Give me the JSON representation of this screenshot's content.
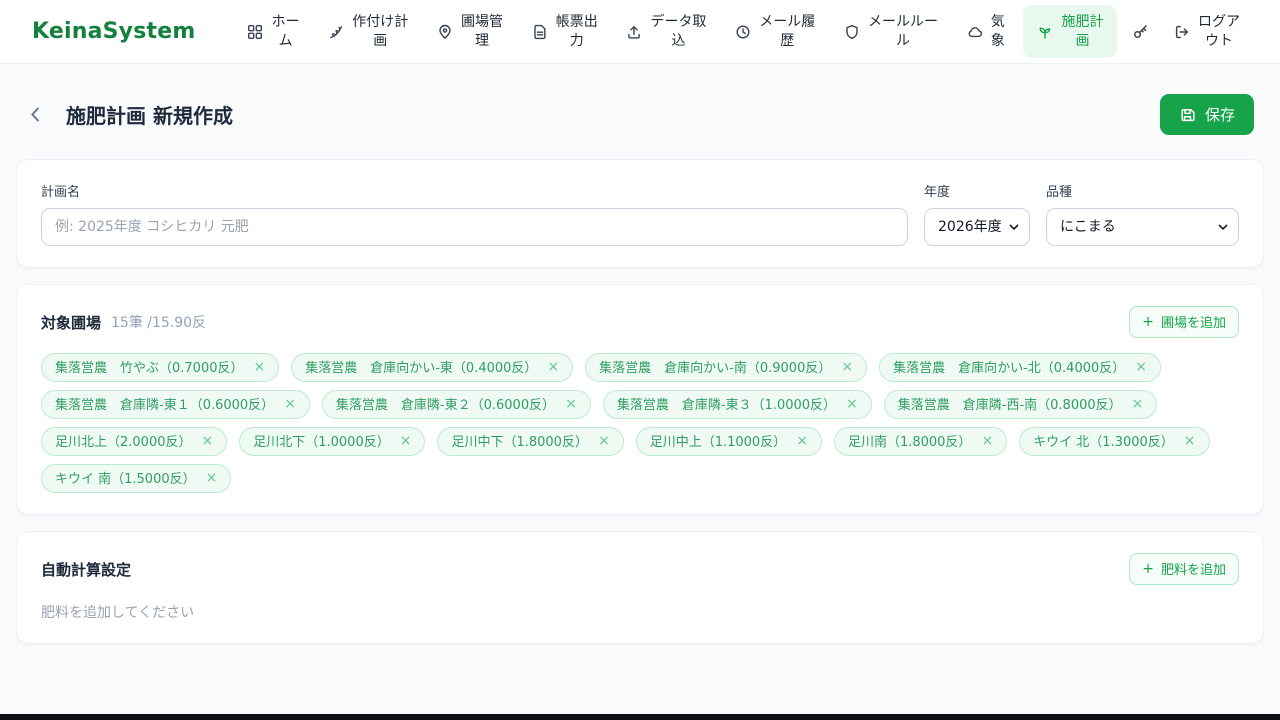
{
  "app": {
    "name": "KeinaSystem"
  },
  "colors": {
    "primary_green": "#16a34a",
    "logo_green": "#15803d",
    "active_nav_bg": "#e8f8ee",
    "chip_bg": "#f0faf4",
    "chip_border": "#bceccd",
    "chip_text": "#2f9e63",
    "page_bg": "#f8fafc"
  },
  "icons": {
    "plus": "+",
    "close": "×"
  },
  "nav": {
    "items": [
      {
        "label": "ホー\nム",
        "icon": "grid"
      },
      {
        "label": "作付け計\n画",
        "icon": "wheat"
      },
      {
        "label": "圃場管\n理",
        "icon": "map-pin"
      },
      {
        "label": "帳票出\n力",
        "icon": "document"
      },
      {
        "label": "データ取\n込",
        "icon": "upload"
      },
      {
        "label": "メール履\n歴",
        "icon": "clock-history"
      },
      {
        "label": "メールルー\nル",
        "icon": "shield"
      },
      {
        "label": "気\n象",
        "icon": "cloud"
      },
      {
        "label": "施肥計\n画",
        "icon": "sprout",
        "active": true
      },
      {
        "label": "",
        "icon": "key"
      },
      {
        "label": "ログア\nウト",
        "icon": "logout"
      }
    ]
  },
  "header": {
    "title": "施肥計画 新規作成",
    "save_label": "保存"
  },
  "plan_form": {
    "name": {
      "label": "計画名",
      "value": "",
      "placeholder": "例: 2025年度 コシヒカリ 元肥"
    },
    "year": {
      "label": "年度",
      "value": "2026年度"
    },
    "variety": {
      "label": "品種",
      "value": "にこまる"
    }
  },
  "fields_section": {
    "title": "対象圃場",
    "summary": "15筆 /15.90反",
    "add_label": "圃場を追加",
    "chips": [
      "集落営農　竹やぶ（0.7000反）",
      "集落営農　倉庫向かい-東（0.4000反）",
      "集落営農　倉庫向かい-南（0.9000反）",
      "集落営農　倉庫向かい-北（0.4000反）",
      "集落営農　倉庫隣-東１（0.6000反）",
      "集落営農　倉庫隣-東２（0.6000反）",
      "集落営農　倉庫隣-東３（1.0000反）",
      "集落営農　倉庫隣-西-南（0.8000反）",
      "足川北上（2.0000反）",
      "足川北下（1.0000反）",
      "足川中下（1.8000反）",
      "足川中上（1.1000反）",
      "足川南（1.8000反）",
      "キウイ 北（1.3000反）",
      "キウイ 南（1.5000反）"
    ]
  },
  "auto_section": {
    "title": "自動計算設定",
    "add_label": "肥料を追加",
    "empty_text": "肥料を追加してください"
  }
}
